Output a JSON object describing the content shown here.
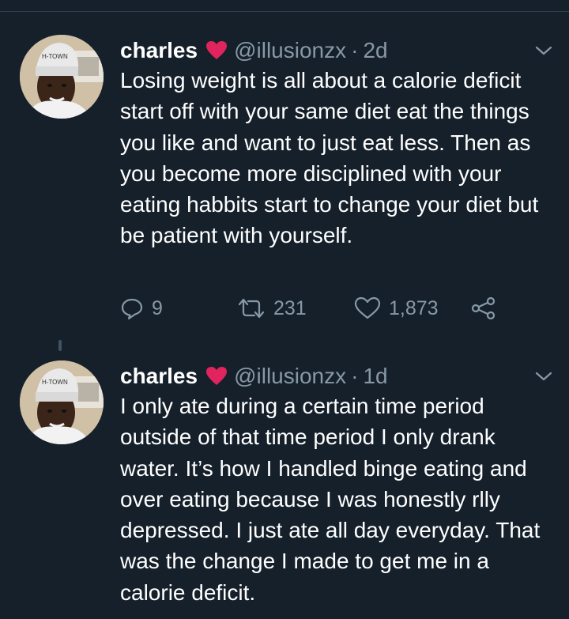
{
  "tweets": [
    {
      "name": "charles",
      "handle": "@illusionzx",
      "separator": "·",
      "time": "2d",
      "text": "Losing weight is all about a calorie deficit start off with your same diet eat the things you like and want to just eat less. Then as you become more disciplined with your eating habbits start to change your diet but be patient with yourself.",
      "replies": "9",
      "retweets": "231",
      "likes": "1,873"
    },
    {
      "name": "charles",
      "handle": "@illusionzx",
      "separator": "·",
      "time": "1d",
      "text": "I only ate during a certain time period outside of that time period I only drank water. It’s how I handled binge eating and over eating because I was honestly rlly depressed. I just ate all day everyday. That was the change I made to get me in a calorie deficit."
    }
  ],
  "icons": {
    "verified_emoji": "red-heart-icon",
    "menu": "chevron-down-icon",
    "reply": "reply-icon",
    "retweet": "retweet-icon",
    "like": "like-icon",
    "share": "share-icon"
  },
  "colors": {
    "background": "#15202b",
    "secondary_text": "#8899a6",
    "heart": "#e0245e"
  }
}
